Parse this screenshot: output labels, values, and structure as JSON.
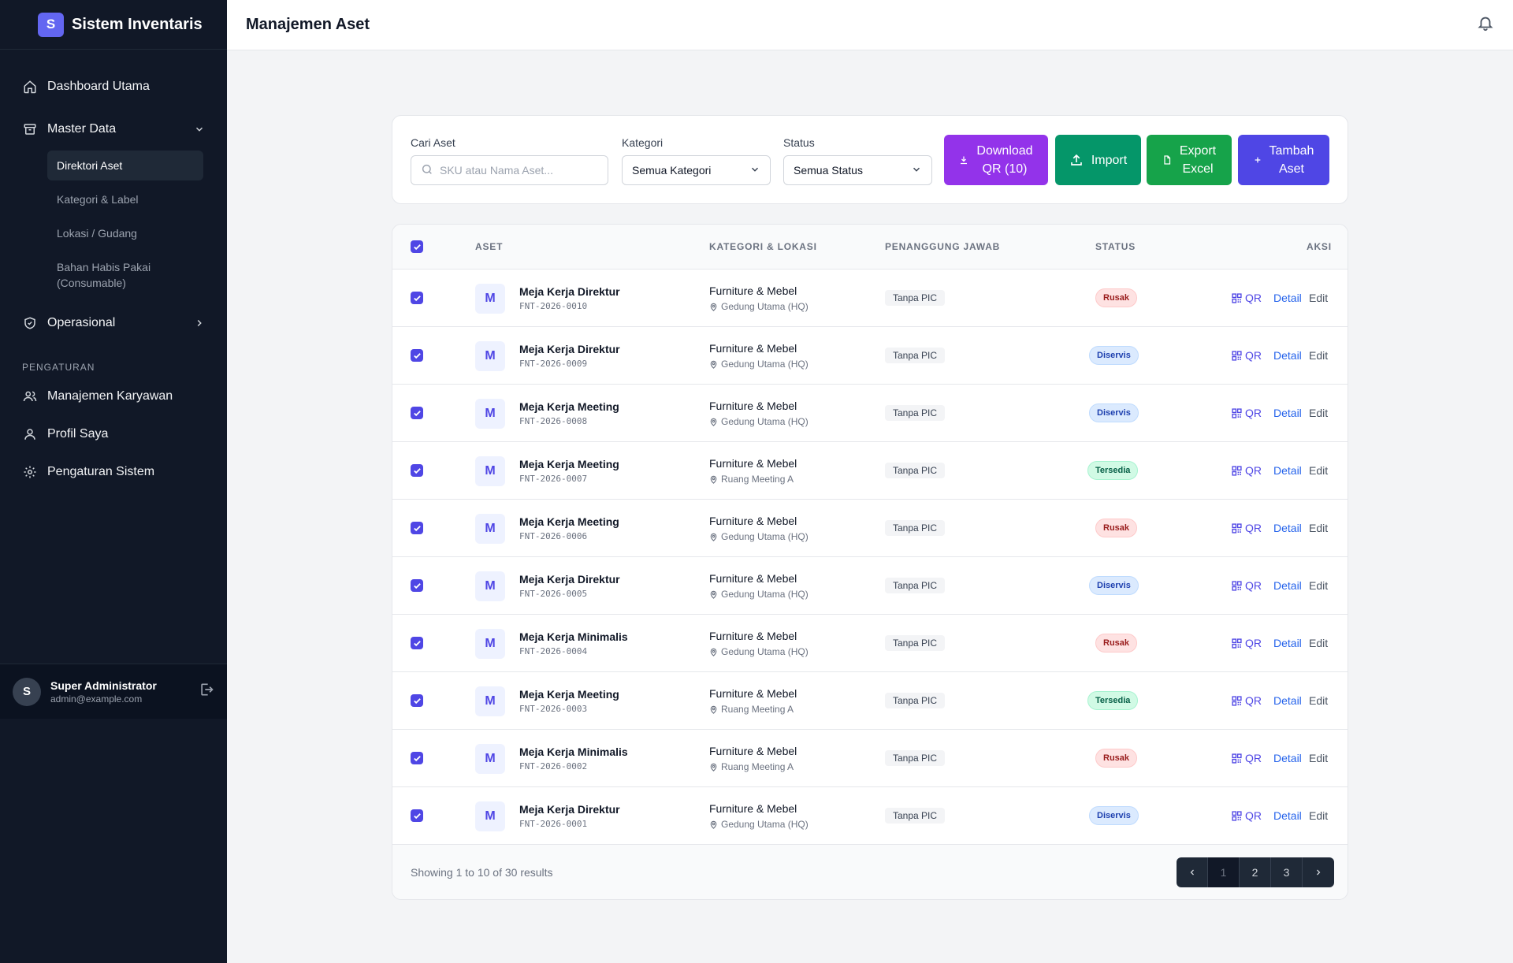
{
  "app": {
    "logo_letter": "S",
    "title": "Sistem Inventaris"
  },
  "header": {
    "title": "Manajemen Aset",
    "notification_icon": "bell-icon"
  },
  "sidebar": {
    "nav_dashboard": "Dashboard Utama",
    "nav_master": "Master Data",
    "sub_items": [
      "Direktori Aset",
      "Kategori & Label",
      "Lokasi / Gudang",
      "Bahan Habis Pakai (Consumable)"
    ],
    "active_sub": "Direktori Aset",
    "nav_operasional": "Operasional",
    "section_settings": "PENGATURAN",
    "nav_karyawan": "Manajemen Karyawan",
    "nav_profil": "Profil Saya",
    "nav_pengaturan": "Pengaturan Sistem",
    "user": {
      "initial": "S",
      "name": "Super Administrator",
      "email": "admin@example.com"
    }
  },
  "filters": {
    "search_label": "Cari Aset",
    "search_placeholder": "SKU atau Nama Aset...",
    "category_label": "Kategori",
    "category_value": "Semua Kategori",
    "status_label": "Status",
    "status_value": "Semua Status",
    "btn_download_line1": "Download",
    "btn_download_line2": "QR (10)",
    "btn_import": "Import",
    "btn_export_line1": "Export",
    "btn_export_line2": "Excel",
    "btn_add_line1": "Tambah",
    "btn_add_line2": "Aset"
  },
  "colors": {
    "sidebar_bg": "#111827",
    "accent": "#4f46e5",
    "download": "#9333ea",
    "import": "#059669",
    "export": "#16a34a",
    "add": "#4f46e5"
  },
  "table": {
    "headers": {
      "asset": "ASET",
      "category": "KATEGORI & LOKASI",
      "pic": "PENANGGUNG JAWAB",
      "status": "STATUS",
      "actions": "AKSI"
    },
    "action_qr": "QR",
    "action_detail": "Detail",
    "action_edit": "Edit",
    "rows": [
      {
        "letter": "M",
        "name": "Meja Kerja Direktur",
        "sku": "FNT-2026-0010",
        "category": "Furniture & Mebel",
        "location": "Gedung Utama (HQ)",
        "pic": "Tanpa PIC",
        "status": "Rusak",
        "checked": true
      },
      {
        "letter": "M",
        "name": "Meja Kerja Direktur",
        "sku": "FNT-2026-0009",
        "category": "Furniture & Mebel",
        "location": "Gedung Utama (HQ)",
        "pic": "Tanpa PIC",
        "status": "Diservis",
        "checked": true
      },
      {
        "letter": "M",
        "name": "Meja Kerja Meeting",
        "sku": "FNT-2026-0008",
        "category": "Furniture & Mebel",
        "location": "Gedung Utama (HQ)",
        "pic": "Tanpa PIC",
        "status": "Diservis",
        "checked": true
      },
      {
        "letter": "M",
        "name": "Meja Kerja Meeting",
        "sku": "FNT-2026-0007",
        "category": "Furniture & Mebel",
        "location": "Ruang Meeting A",
        "pic": "Tanpa PIC",
        "status": "Tersedia",
        "checked": true
      },
      {
        "letter": "M",
        "name": "Meja Kerja Meeting",
        "sku": "FNT-2026-0006",
        "category": "Furniture & Mebel",
        "location": "Gedung Utama (HQ)",
        "pic": "Tanpa PIC",
        "status": "Rusak",
        "checked": true
      },
      {
        "letter": "M",
        "name": "Meja Kerja Direktur",
        "sku": "FNT-2026-0005",
        "category": "Furniture & Mebel",
        "location": "Gedung Utama (HQ)",
        "pic": "Tanpa PIC",
        "status": "Diservis",
        "checked": true
      },
      {
        "letter": "M",
        "name": "Meja Kerja Minimalis",
        "sku": "FNT-2026-0004",
        "category": "Furniture & Mebel",
        "location": "Gedung Utama (HQ)",
        "pic": "Tanpa PIC",
        "status": "Rusak",
        "checked": true
      },
      {
        "letter": "M",
        "name": "Meja Kerja Meeting",
        "sku": "FNT-2026-0003",
        "category": "Furniture & Mebel",
        "location": "Ruang Meeting A",
        "pic": "Tanpa PIC",
        "status": "Tersedia",
        "checked": true
      },
      {
        "letter": "M",
        "name": "Meja Kerja Minimalis",
        "sku": "FNT-2026-0002",
        "category": "Furniture & Mebel",
        "location": "Ruang Meeting A",
        "pic": "Tanpa PIC",
        "status": "Rusak",
        "checked": true
      },
      {
        "letter": "M",
        "name": "Meja Kerja Direktur",
        "sku": "FNT-2026-0001",
        "category": "Furniture & Mebel",
        "location": "Gedung Utama (HQ)",
        "pic": "Tanpa PIC",
        "status": "Diservis",
        "checked": true
      }
    ],
    "footer_text": "Showing 1 to 10 of 30 results",
    "pages": [
      "1",
      "2",
      "3"
    ],
    "current_page": "1"
  }
}
